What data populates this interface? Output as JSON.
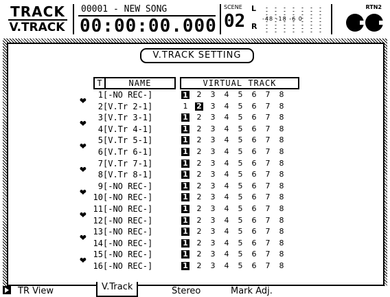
{
  "header": {
    "track_label": "TRACK",
    "vtrack_label": "V.TRACK",
    "song_name": "00001 - NEW SONG",
    "time_counter": "00:00:00.000",
    "scene_label": "SCENE",
    "scene_number": "02",
    "meter_left": "L",
    "meter_right": "R",
    "meter_ticks": "-48  -18  -6  0",
    "rtn_label": "RTN2"
  },
  "panel": {
    "title": "V.TRACK SETTING",
    "col_t": "T",
    "col_name": "NAME",
    "col_vt": "VIRTUAL TRACK"
  },
  "tracks": [
    {
      "num": "1",
      "name": "[-NO REC-]",
      "vt": "1",
      "sel": [
        true,
        false,
        false,
        false,
        false,
        false,
        false,
        false
      ],
      "cur": [
        true,
        false,
        false,
        false,
        false,
        false,
        false,
        false
      ]
    },
    {
      "num": "2",
      "name": "[V.Tr 2-1]",
      "vt": "2",
      "sel": [
        false,
        true,
        false,
        false,
        false,
        false,
        false,
        false
      ],
      "cur": [
        false,
        false,
        false,
        false,
        false,
        false,
        false,
        false
      ]
    },
    {
      "num": "3",
      "name": "[V.Tr 3-1]",
      "vt": "1",
      "sel": [
        true,
        false,
        false,
        false,
        false,
        false,
        false,
        false
      ],
      "cur": [
        false,
        false,
        false,
        false,
        false,
        false,
        false,
        false
      ]
    },
    {
      "num": "4",
      "name": "[V.Tr 4-1]",
      "vt": "1",
      "sel": [
        true,
        false,
        false,
        false,
        false,
        false,
        false,
        false
      ],
      "cur": [
        false,
        false,
        false,
        false,
        false,
        false,
        false,
        false
      ]
    },
    {
      "num": "5",
      "name": "[V.Tr 5-1]",
      "vt": "1",
      "sel": [
        true,
        false,
        false,
        false,
        false,
        false,
        false,
        false
      ],
      "cur": [
        false,
        false,
        false,
        false,
        false,
        false,
        false,
        false
      ]
    },
    {
      "num": "6",
      "name": "[V.Tr 6-1]",
      "vt": "1",
      "sel": [
        true,
        false,
        false,
        false,
        false,
        false,
        false,
        false
      ],
      "cur": [
        false,
        false,
        false,
        false,
        false,
        false,
        false,
        false
      ]
    },
    {
      "num": "7",
      "name": "[V.Tr 7-1]",
      "vt": "1",
      "sel": [
        true,
        false,
        false,
        false,
        false,
        false,
        false,
        false
      ],
      "cur": [
        false,
        false,
        false,
        false,
        false,
        false,
        false,
        false
      ]
    },
    {
      "num": "8",
      "name": "[V.Tr 8-1]",
      "vt": "1",
      "sel": [
        true,
        false,
        false,
        false,
        false,
        false,
        false,
        false
      ],
      "cur": [
        false,
        false,
        false,
        false,
        false,
        false,
        false,
        false
      ]
    },
    {
      "num": "9",
      "name": "[-NO REC-]",
      "vt": "1",
      "sel": [
        true,
        false,
        false,
        false,
        false,
        false,
        false,
        false
      ],
      "cur": [
        false,
        false,
        false,
        false,
        false,
        false,
        false,
        false
      ]
    },
    {
      "num": "10",
      "name": "[-NO REC-]",
      "vt": "1",
      "sel": [
        true,
        false,
        false,
        false,
        false,
        false,
        false,
        false
      ],
      "cur": [
        false,
        false,
        false,
        false,
        false,
        false,
        false,
        false
      ]
    },
    {
      "num": "11",
      "name": "[-NO REC-]",
      "vt": "1",
      "sel": [
        true,
        false,
        false,
        false,
        false,
        false,
        false,
        false
      ],
      "cur": [
        false,
        false,
        false,
        false,
        false,
        false,
        false,
        false
      ]
    },
    {
      "num": "12",
      "name": "[-NO REC-]",
      "vt": "1",
      "sel": [
        true,
        false,
        false,
        false,
        false,
        false,
        false,
        false
      ],
      "cur": [
        false,
        false,
        false,
        false,
        false,
        false,
        false,
        false
      ]
    },
    {
      "num": "13",
      "name": "[-NO REC-]",
      "vt": "1",
      "sel": [
        true,
        false,
        false,
        false,
        false,
        false,
        false,
        false
      ],
      "cur": [
        false,
        false,
        false,
        false,
        false,
        false,
        false,
        false
      ]
    },
    {
      "num": "14",
      "name": "[-NO REC-]",
      "vt": "1",
      "sel": [
        true,
        false,
        false,
        false,
        false,
        false,
        false,
        false
      ],
      "cur": [
        false,
        false,
        false,
        false,
        false,
        false,
        false,
        false
      ]
    },
    {
      "num": "15",
      "name": "[-NO REC-]",
      "vt": "1",
      "sel": [
        true,
        false,
        false,
        false,
        false,
        false,
        false,
        false
      ],
      "cur": [
        false,
        false,
        false,
        false,
        false,
        false,
        false,
        false
      ]
    },
    {
      "num": "16",
      "name": "[-NO REC-]",
      "vt": "1",
      "sel": [
        true,
        false,
        false,
        false,
        false,
        false,
        false,
        false
      ],
      "cur": [
        false,
        false,
        false,
        false,
        false,
        false,
        false,
        false
      ]
    }
  ],
  "vt_numbers": [
    "1",
    "2",
    "3",
    "4",
    "5",
    "6",
    "7",
    "8"
  ],
  "pair_icon": "pair-link-icon",
  "tabs": [
    {
      "label": "TR View",
      "active": false
    },
    {
      "label": "V.Track",
      "active": true
    },
    {
      "label": "Stereo",
      "active": false
    },
    {
      "label": "Mark Adj.",
      "active": false
    }
  ]
}
